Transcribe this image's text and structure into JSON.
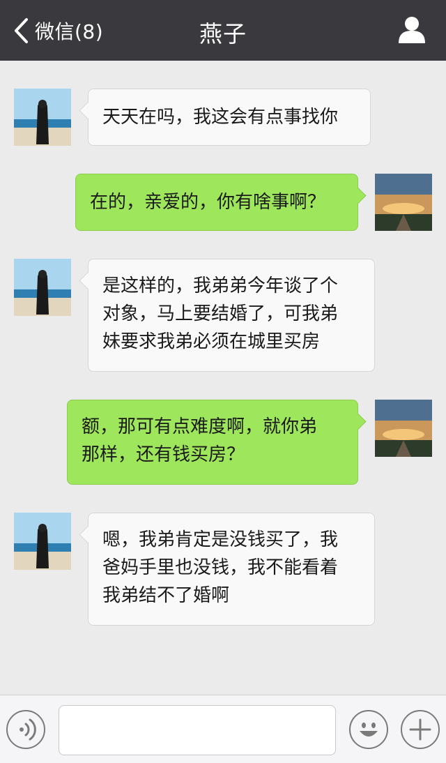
{
  "header": {
    "back_label": "微信(8)",
    "title": "燕子",
    "back_icon": "chevron-left-icon",
    "profile_icon": "person-icon"
  },
  "contact": {
    "name": "燕子"
  },
  "messages": [
    {
      "from": "contact",
      "text": "天天在吗，我这会有点事找你"
    },
    {
      "from": "me",
      "text": "在的，亲爱的，你有啥事啊？"
    },
    {
      "from": "contact",
      "lines": [
        "是这样的，我弟弟今年谈了个",
        "对象，马上要结婚了，可我弟",
        "妹要求我弟必须在城里买房"
      ]
    },
    {
      "from": "me",
      "lines": [
        "额，那可有点难度啊，就你弟",
        "那样，还有钱买房？"
      ]
    },
    {
      "from": "contact",
      "lines": [
        "嗯，我弟肯定是没钱买了，我",
        "爸妈手里也没钱，我不能看着",
        "我弟结不了婚啊"
      ]
    }
  ],
  "input_bar": {
    "input_value": "",
    "voice_icon": "voice-icon",
    "emoji_icon": "emoji-icon",
    "plus_icon": "plus-icon"
  },
  "colors": {
    "header_bg": "#3a3a3e",
    "chat_bg": "#ebebeb",
    "outgoing_bubble": "#9ee65b",
    "incoming_bubble": "#f9f9f9"
  }
}
